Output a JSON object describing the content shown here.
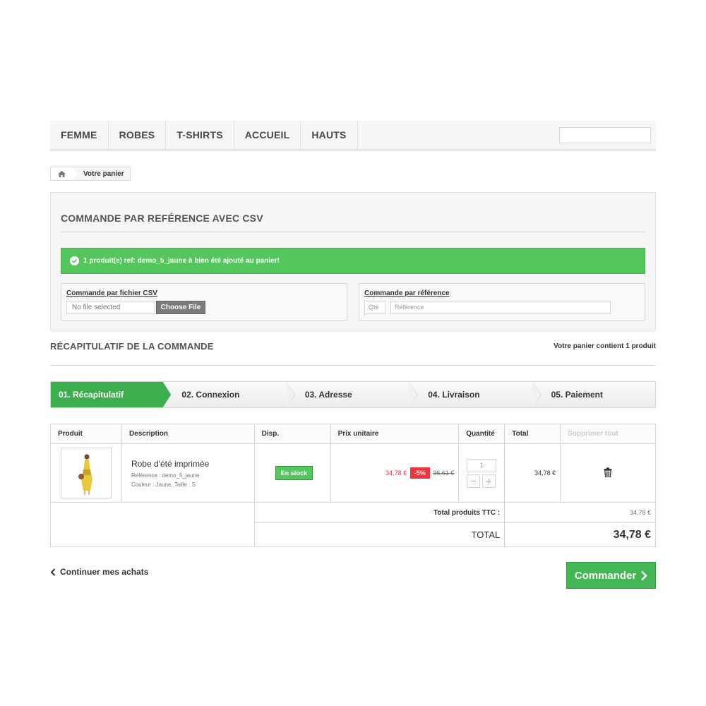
{
  "nav": {
    "items": [
      "FEMME",
      "ROBES",
      "T-SHIRTS",
      "ACCUEIL",
      "HAUTS"
    ],
    "search_value": ""
  },
  "breadcrumb": {
    "current": "Votre panier"
  },
  "csv_panel": {
    "title": "COMMANDE PAR REFÉRENCE AVEC CSV",
    "alert": "1 produit(s) ref: demo_5_jaune à bien été ajouté au panier!",
    "file_box": {
      "label": "Commande par fichier CSV",
      "file_text": "No file selected",
      "button": "Choose File"
    },
    "ref_box": {
      "label": "Commande par référence",
      "qty_placeholder": "Qté",
      "ref_placeholder": "Référence"
    }
  },
  "summary": {
    "title": "RÉCAPITULATIF DE LA COMMANDE",
    "count": "Votre panier contient 1 produit"
  },
  "steps": [
    "01. Récapitulatif",
    "02. Connexion",
    "03. Adresse",
    "04. Livraison",
    "05. Paiement"
  ],
  "cart": {
    "headers": [
      "Produit",
      "Description",
      "Disp.",
      "Prix unitaire",
      "Quantité",
      "Total",
      "Supprimer tout"
    ],
    "product": {
      "name": "Robe d'été imprimée",
      "reference": "Référence : demo_5_jaune",
      "attributes": "Couleur : Jaune, Taille : S",
      "availability": "En stock",
      "price": "34,78 €",
      "discount": "-5%",
      "old_price": "36,61 €",
      "quantity": "1",
      "total": "34,78 €"
    },
    "footer": {
      "products_label": "Total produits TTC :",
      "products_value": "34,78 €",
      "total_label": "TOTAL",
      "total_value": "34,78 €"
    }
  },
  "actions": {
    "continue": "Continuer mes achats",
    "order": "Commander"
  },
  "colors": {
    "accent_green": "#3dae4d",
    "alert_green": "#55c65e",
    "discount_red": "#f13340"
  }
}
